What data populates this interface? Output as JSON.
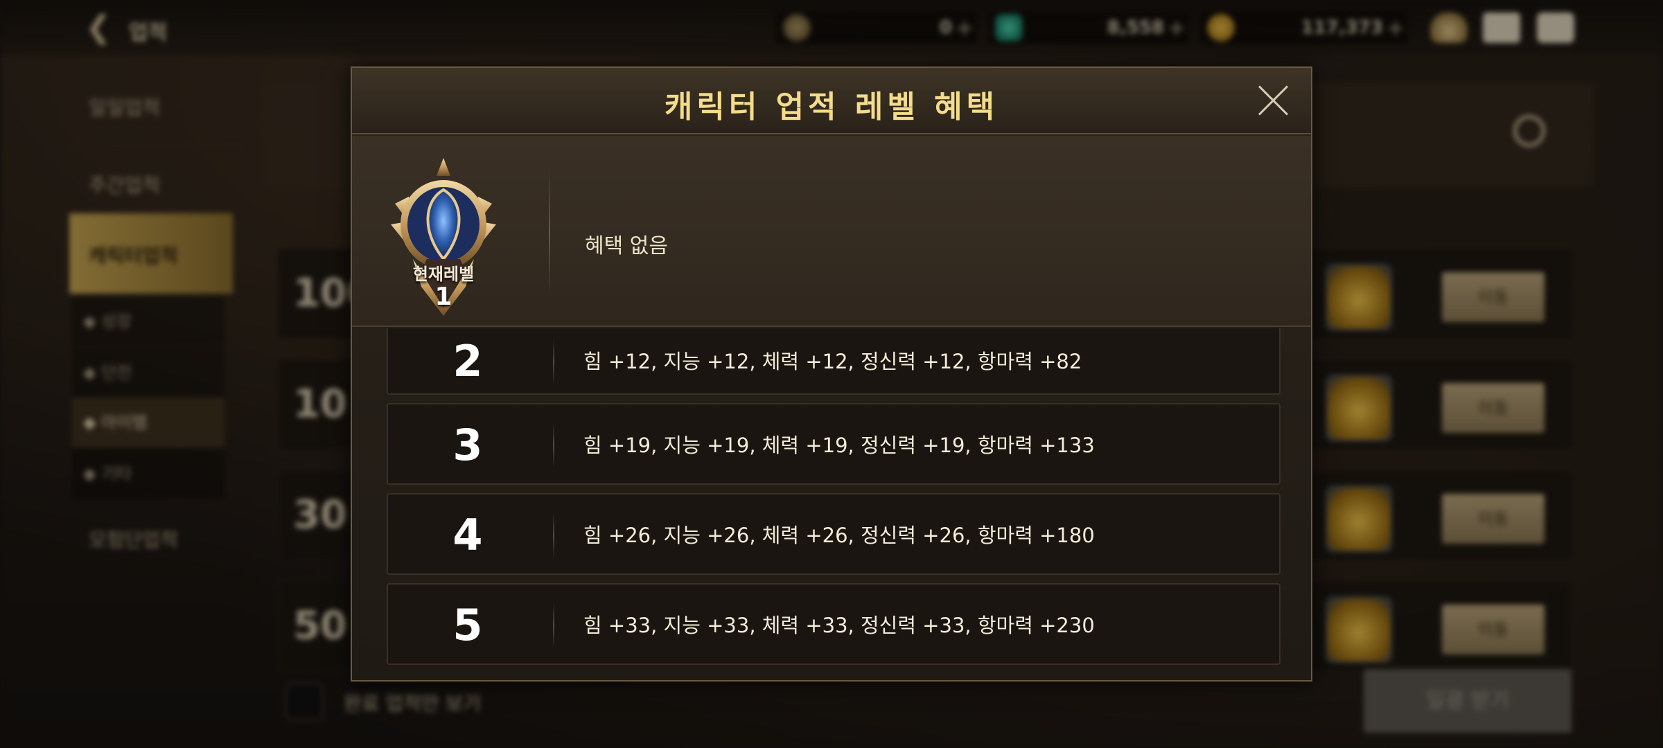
{
  "topbar": {
    "title": "업적",
    "currencies": [
      {
        "name": "coin-c",
        "value": "0"
      },
      {
        "name": "gem",
        "value": "8,558"
      },
      {
        "name": "gold",
        "value": "117,373"
      }
    ],
    "plus": "+"
  },
  "sidebar": {
    "items": [
      "일일업적",
      "주간업적",
      "캐릭터업적",
      "모험단업적"
    ],
    "subitems": [
      "◆ 성장",
      "◆ 던전",
      "◆ 아이템",
      "◆ 기타"
    ]
  },
  "background": {
    "rows": [
      "100",
      "10",
      "30",
      "50"
    ],
    "move_label": "이동",
    "complete_only_label": "완료 업적만 보기",
    "claim_all_label": "일괄 받기"
  },
  "modal": {
    "title": "캐릭터 업적 레벨 혜택",
    "current": {
      "label": "현재레벨",
      "level": "1",
      "benefit": "혜택 없음"
    },
    "levels": [
      {
        "level": "2",
        "stats": "힘 +12, 지능 +12, 체력 +12, 정신력 +12, 항마력 +82"
      },
      {
        "level": "3",
        "stats": "힘 +19, 지능 +19, 체력 +19, 정신력 +19, 항마력 +133"
      },
      {
        "level": "4",
        "stats": "힘 +26, 지능 +26, 체력 +26, 정신력 +26, 항마력 +180"
      },
      {
        "level": "5",
        "stats": "힘 +33, 지능 +33, 체력 +33, 정신력 +33, 항마력 +230"
      }
    ]
  },
  "colors": {
    "title_gold": "#f4dc8a",
    "badge_blue": "#2f4f9c",
    "badge_gold": "#c9a066"
  }
}
